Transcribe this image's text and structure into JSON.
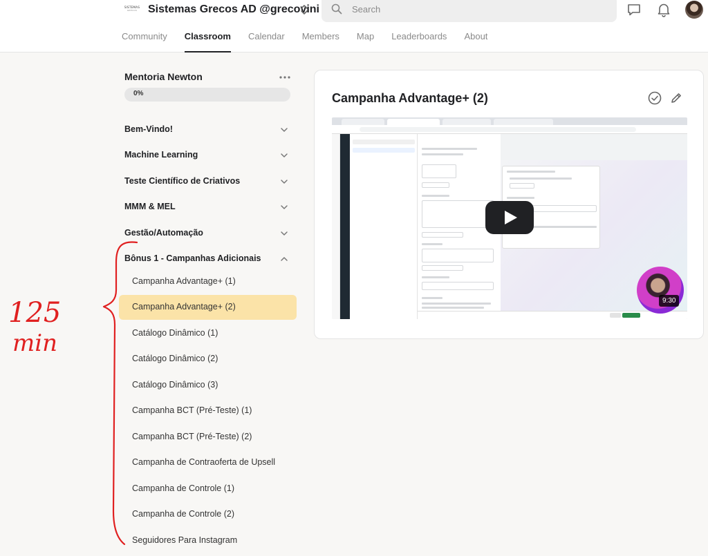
{
  "header": {
    "logo_line1": "SISTEMAS",
    "logo_line2": "GRECOS",
    "group_name": "Sistemas Grecos AD @grecovini",
    "search_placeholder": "Search",
    "tabs": [
      {
        "label": "Community",
        "active": false
      },
      {
        "label": "Classroom",
        "active": true
      },
      {
        "label": "Calendar",
        "active": false
      },
      {
        "label": "Members",
        "active": false
      },
      {
        "label": "Map",
        "active": false
      },
      {
        "label": "Leaderboards",
        "active": false
      },
      {
        "label": "About",
        "active": false
      }
    ]
  },
  "sidebar": {
    "course_title": "Mentoria Newton",
    "progress_label": "0%",
    "progress_value": 0,
    "sections": [
      {
        "label": "Bem-Vindo!",
        "expanded": false
      },
      {
        "label": "Machine Learning",
        "expanded": false
      },
      {
        "label": "Teste Científico de Criativos",
        "expanded": false
      },
      {
        "label": "MMM & MEL",
        "expanded": false
      },
      {
        "label": "Gestão/Automação",
        "expanded": false
      },
      {
        "label": "Bônus 1 - Campanhas Adicionais",
        "expanded": true
      }
    ],
    "lessons": [
      {
        "label": "Campanha Advantage+ (1)",
        "active": false
      },
      {
        "label": "Campanha Advantage+ (2)",
        "active": true
      },
      {
        "label": "Catálogo Dinâmico (1)",
        "active": false
      },
      {
        "label": "Catálogo Dinâmico (2)",
        "active": false
      },
      {
        "label": "Catálogo Dinâmico (3)",
        "active": false
      },
      {
        "label": "Campanha BCT (Pré-Teste) (1)",
        "active": false
      },
      {
        "label": "Campanha BCT (Pré-Teste) (2)",
        "active": false
      },
      {
        "label": "Campanha de Contraoferta de Upsell",
        "active": false
      },
      {
        "label": "Campanha de Controle (1)",
        "active": false
      },
      {
        "label": "Campanha de Controle (2)",
        "active": false
      },
      {
        "label": "Seguidores Para Instagram",
        "active": false
      }
    ]
  },
  "lesson": {
    "title": "Campanha Advantage+ (2)",
    "video_duration": "9:30"
  },
  "annotation": {
    "text_line1": "125",
    "text_line2": "min",
    "color": "#e02020"
  },
  "colors": {
    "active_lesson_bg": "#fbe3a8",
    "page_bg": "#f8f7f5"
  }
}
